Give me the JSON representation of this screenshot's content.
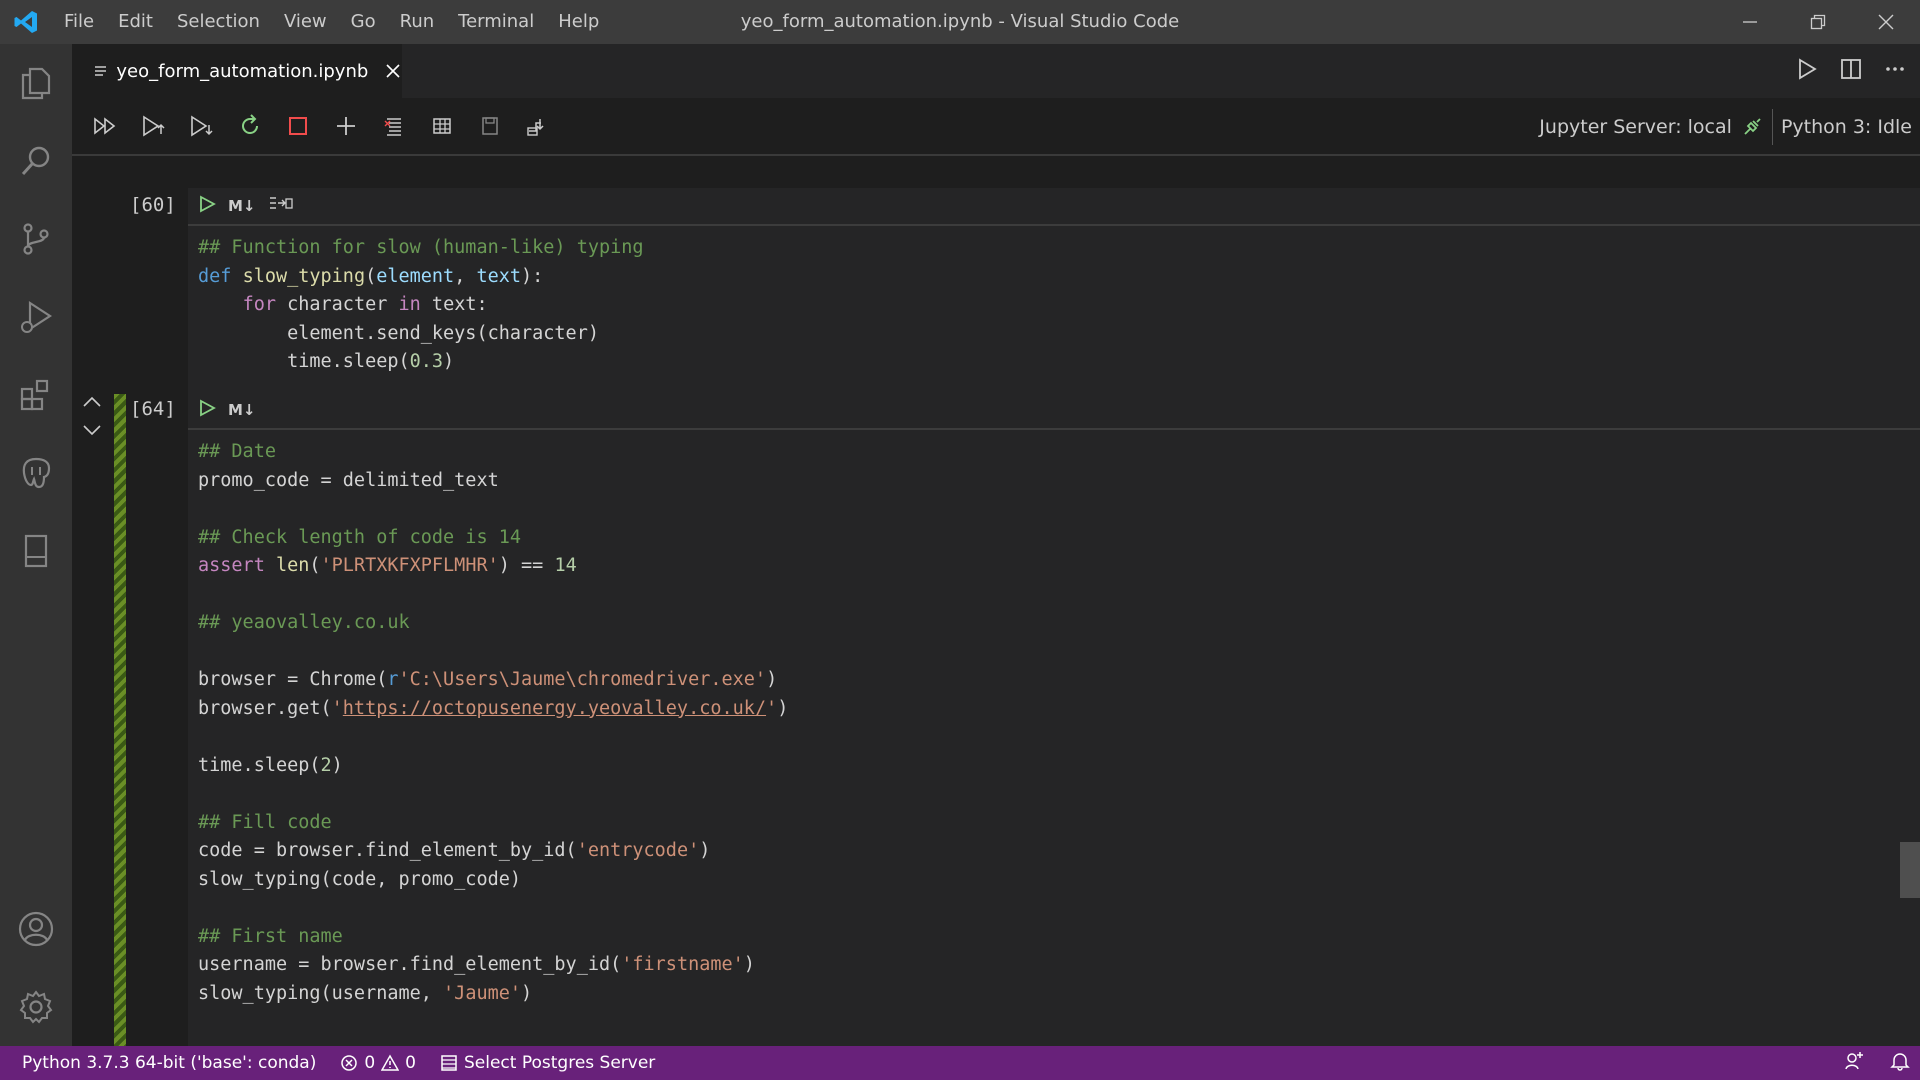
{
  "app": {
    "window_title": "yeo_form_automation.ipynb - Visual Studio Code",
    "menu": [
      "File",
      "Edit",
      "Selection",
      "View",
      "Go",
      "Run",
      "Terminal",
      "Help"
    ]
  },
  "tab": {
    "label": "yeo_form_automation.ipynb"
  },
  "kernel": {
    "server": "Jupyter Server: local",
    "status": "Python 3: Idle"
  },
  "cells": [
    {
      "exec_count": "[60]",
      "md_label": "M↓",
      "lines": [
        [
          [
            "cm",
            "## Function for slow (human-like) typing"
          ]
        ],
        [
          [
            "kw",
            "def"
          ],
          [
            "",
            " "
          ],
          [
            "fn",
            "slow_typing"
          ],
          [
            "",
            "("
          ],
          [
            "pa",
            "element"
          ],
          [
            "",
            ", "
          ],
          [
            "pa",
            "text"
          ],
          [
            "",
            "):"
          ]
        ],
        [
          [
            "",
            "    "
          ],
          [
            "kw2",
            "for"
          ],
          [
            "",
            " character "
          ],
          [
            "kw2",
            "in"
          ],
          [
            "",
            " text:"
          ]
        ],
        [
          [
            "",
            "        element.send_keys(character)"
          ]
        ],
        [
          [
            "",
            "        time.sleep("
          ],
          [
            "nu",
            "0.3"
          ],
          [
            "",
            ")"
          ]
        ]
      ]
    },
    {
      "exec_count": "[64]",
      "md_label": "M↓",
      "lines": [
        [
          [
            "cm",
            "## Date"
          ]
        ],
        [
          [
            "",
            "promo_code = delimited_text"
          ]
        ],
        [
          [
            "",
            ""
          ]
        ],
        [
          [
            "cm",
            "## Check length of code is 14"
          ]
        ],
        [
          [
            "kw2",
            "assert"
          ],
          [
            "",
            " "
          ],
          [
            "fn",
            "len"
          ],
          [
            "",
            "("
          ],
          [
            "st",
            "'PLRTXKFXPFLMHR'"
          ],
          [
            "",
            ") == "
          ],
          [
            "nu",
            "14"
          ]
        ],
        [
          [
            "",
            ""
          ]
        ],
        [
          [
            "cm",
            "## yeaovalley.co.uk"
          ]
        ],
        [
          [
            "",
            ""
          ]
        ],
        [
          [
            "",
            "browser = Chrome("
          ],
          [
            "kw",
            "r"
          ],
          [
            "st",
            "'C:\\Users\\Jaume\\chromedriver.exe'"
          ],
          [
            "",
            ")"
          ]
        ],
        [
          [
            "",
            "browser.get("
          ],
          [
            "st",
            "'"
          ],
          [
            "st url",
            "https://octopusenergy.yeovalley.co.uk/"
          ],
          [
            "st",
            "'"
          ],
          [
            "",
            ")"
          ]
        ],
        [
          [
            "",
            ""
          ]
        ],
        [
          [
            "",
            "time.sleep("
          ],
          [
            "nu",
            "2"
          ],
          [
            "",
            ")"
          ]
        ],
        [
          [
            "",
            ""
          ]
        ],
        [
          [
            "cm",
            "## Fill code"
          ]
        ],
        [
          [
            "",
            "code = browser.find_element_by_id("
          ],
          [
            "st",
            "'entrycode'"
          ],
          [
            "",
            ")"
          ]
        ],
        [
          [
            "",
            "slow_typing(code, promo_code)"
          ]
        ],
        [
          [
            "",
            ""
          ]
        ],
        [
          [
            "cm",
            "## First name"
          ]
        ],
        [
          [
            "",
            "username = browser.find_element_by_id("
          ],
          [
            "st",
            "'firstname'"
          ],
          [
            "",
            ")"
          ]
        ],
        [
          [
            "",
            "slow_typing(username, "
          ],
          [
            "st",
            "'Jaume'"
          ],
          [
            "",
            ")"
          ]
        ]
      ]
    }
  ],
  "statusbar": {
    "interpreter": "Python 3.7.3 64-bit ('base': conda)",
    "errors": "0",
    "warnings": "0",
    "postgres": "Select Postgres Server"
  },
  "colors": {
    "statusbar": "#68217a",
    "accent": "#007acc"
  }
}
